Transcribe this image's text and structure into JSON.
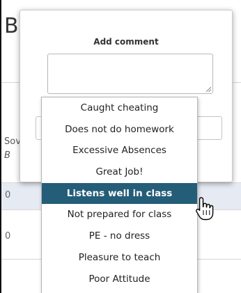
{
  "background": {
    "header_fragment": "B",
    "column_fragment_top": "Sov",
    "column_fragment_bottom": "B",
    "row_fragments": [
      "0",
      "0"
    ]
  },
  "popup": {
    "title": "Add comment",
    "comment_value": "",
    "dropdown": {
      "options": [
        "Caught cheating",
        "Does not do homework",
        "Excessive Absences",
        "Great Job!",
        "Listens well in class",
        "Not prepared for class",
        "PE - no dress",
        "Pleasure to teach",
        "Poor Attitude"
      ],
      "highlighted": "Listens well in class"
    }
  },
  "colors": {
    "highlight": "#245d78",
    "row_tint": "#e6eaf3",
    "border": "#c9c9c9"
  },
  "icons": [
    "resize-grip-icon",
    "hand-pointer-icon"
  ]
}
